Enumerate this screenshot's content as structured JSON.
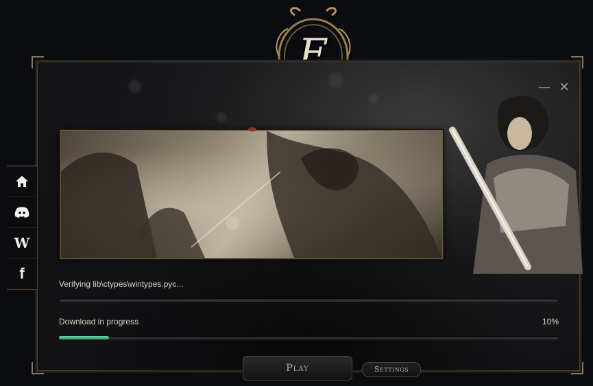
{
  "window": {
    "emblem_letter": "E",
    "minimize_symbol": "—",
    "close_symbol": "✕"
  },
  "sidebar": {
    "items": [
      {
        "name": "home",
        "icon": "home-icon"
      },
      {
        "name": "discord",
        "icon": "discord-icon"
      },
      {
        "name": "wiki",
        "icon": "wiki-icon",
        "glyph": "W"
      },
      {
        "name": "facebook",
        "icon": "facebook-icon",
        "glyph": "f"
      }
    ]
  },
  "progress": {
    "file_status": "Verifying lib\\ctypes\\wintypes.pyc...",
    "file_fraction": 0,
    "download_label": "Download in progress",
    "download_percent_text": "10%",
    "download_fraction": 0.1
  },
  "buttons": {
    "play": "Play",
    "settings": "Settings"
  },
  "colors": {
    "accent_progress": "#3fb487",
    "gold_trim": "#8a7656"
  }
}
